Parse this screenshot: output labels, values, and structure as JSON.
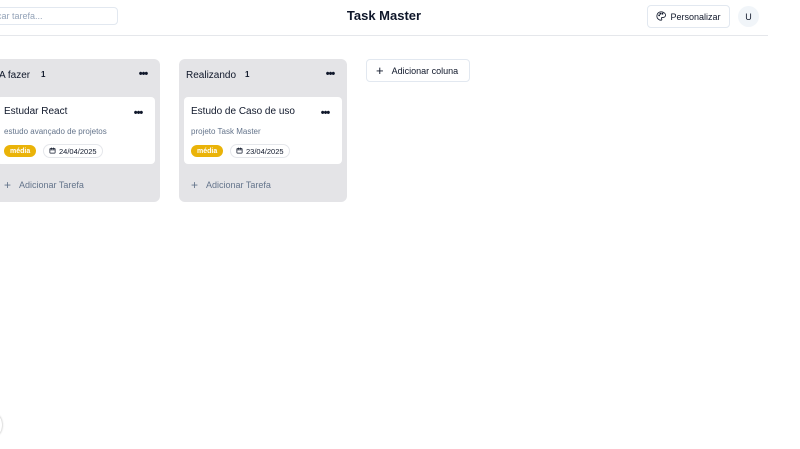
{
  "header": {
    "search_placeholder": "car tarefa...",
    "title": "Task Master",
    "customize_label": "Personalizar",
    "avatar_initial": "U"
  },
  "columns": [
    {
      "title": "A fazer",
      "count": "1",
      "cards": [
        {
          "title": "Estudar React",
          "description": "estudo avançado de projetos",
          "priority": "média",
          "date": "24/04/2025"
        }
      ],
      "add_task_label": "Adicionar Tarefa"
    },
    {
      "title": "Realizando",
      "count": "1",
      "cards": [
        {
          "title": "Estudo de Caso de uso",
          "description": "projeto Task Master",
          "priority": "média",
          "date": "23/04/2025"
        }
      ],
      "add_task_label": "Adicionar Tarefa"
    }
  ],
  "add_column_label": "Adicionar coluna",
  "icons": {
    "palette": "palette-icon",
    "calendar": "calendar-icon",
    "plus": "plus-icon",
    "more": "more-horizontal-icon"
  },
  "colors": {
    "column_bg": "#e4e4e7",
    "priority_medium": "#eab308",
    "border": "#e2e8f0"
  }
}
